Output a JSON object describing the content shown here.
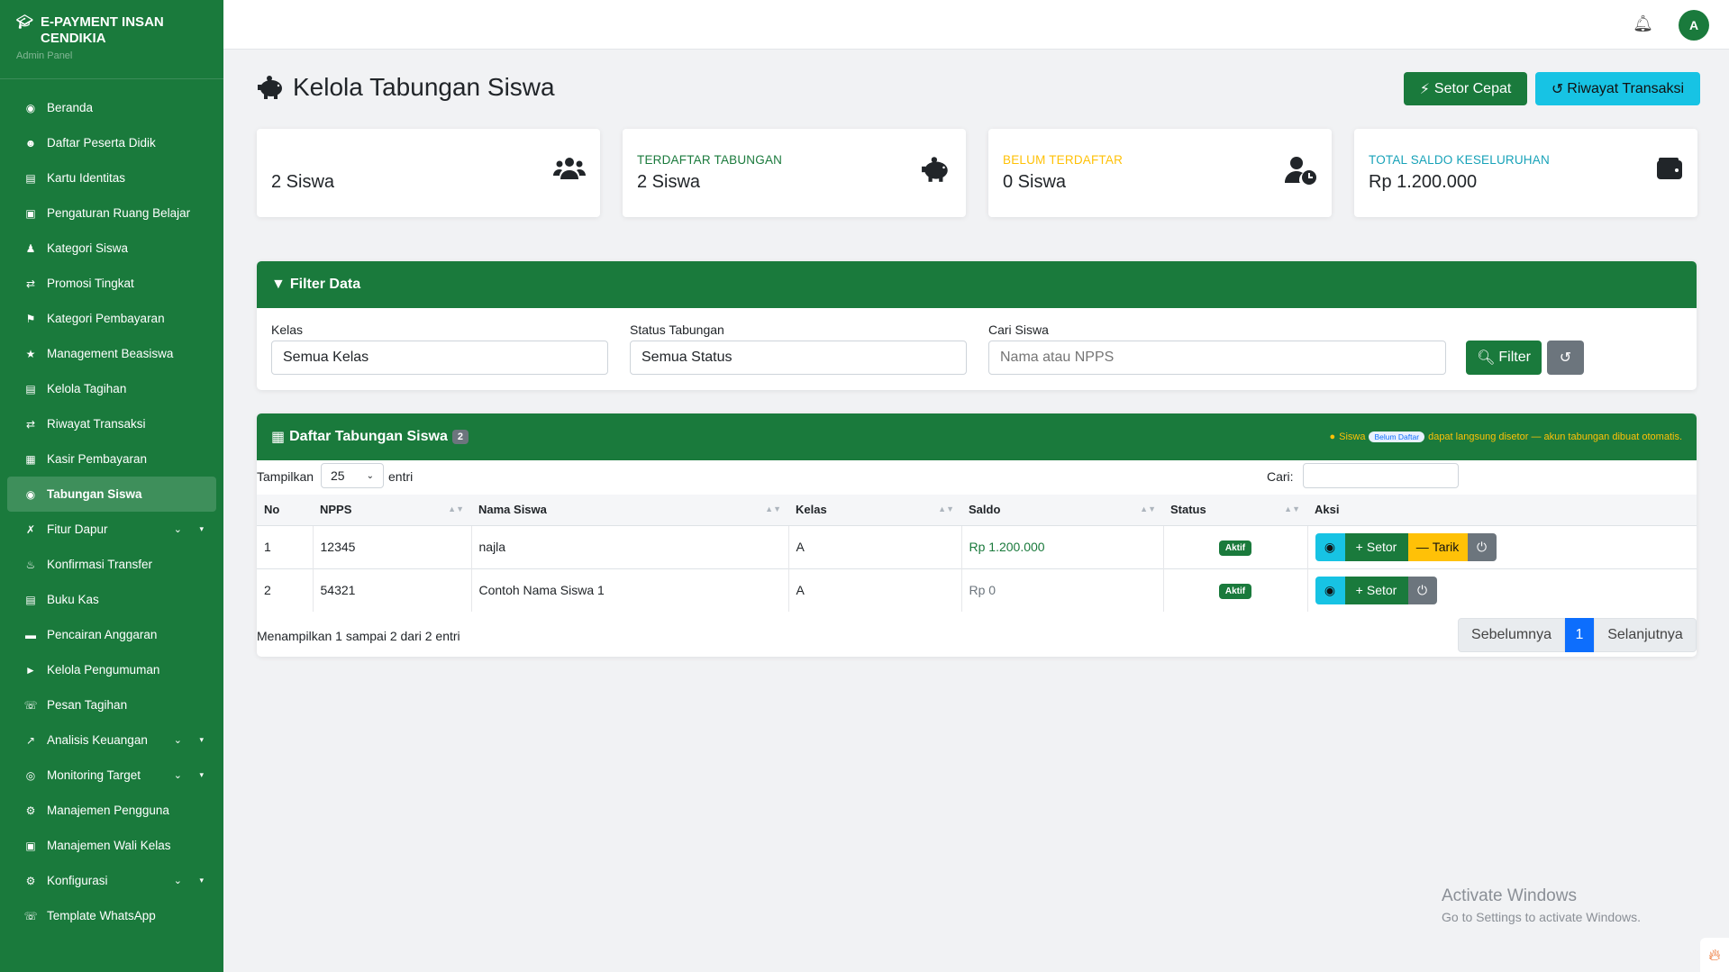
{
  "sidebar": {
    "brand_title": "E-PAYMENT INSAN CENDIKIA",
    "brand_sub": "Admin Panel",
    "items": [
      {
        "label": "Beranda",
        "icon": "dashboard-icon"
      },
      {
        "label": "Daftar Peserta Didik",
        "icon": "users-icon"
      },
      {
        "label": "Kartu Identitas",
        "icon": "id-card-icon"
      },
      {
        "label": "Pengaturan Ruang Belajar",
        "icon": "chalkboard-icon"
      },
      {
        "label": "Kategori Siswa",
        "icon": "child-icon"
      },
      {
        "label": "Promosi Tingkat",
        "icon": "exchange-icon"
      },
      {
        "label": "Kategori Pembayaran",
        "icon": "tags-icon"
      },
      {
        "label": "Management Beasiswa",
        "icon": "award-icon"
      },
      {
        "label": "Kelola Tagihan",
        "icon": "file-invoice-icon"
      },
      {
        "label": "Riwayat Transaksi",
        "icon": "exchange-icon"
      },
      {
        "label": "Kasir Pembayaran",
        "icon": "cash-register-icon"
      },
      {
        "label": "Tabungan Siswa",
        "icon": "piggy-bank-icon"
      },
      {
        "label": "Fitur Dapur",
        "icon": "utensils-icon"
      },
      {
        "label": "Konfirmasi Transfer",
        "icon": "bell-icon"
      },
      {
        "label": "Buku Kas",
        "icon": "book-icon"
      },
      {
        "label": "Pencairan Anggaran",
        "icon": "money-bill-icon"
      },
      {
        "label": "Kelola Pengumuman",
        "icon": "bullhorn-icon"
      },
      {
        "label": "Pesan Tagihan",
        "icon": "whatsapp-icon"
      },
      {
        "label": "Analisis Keuangan",
        "icon": "chart-line-icon"
      },
      {
        "label": "Monitoring Target",
        "icon": "bullseye-icon"
      },
      {
        "label": "Manajemen Pengguna",
        "icon": "user-cog-icon"
      },
      {
        "label": "Manajemen Wali Kelas",
        "icon": "chalkboard-teacher-icon"
      },
      {
        "label": "Konfigurasi",
        "icon": "gear-icon"
      },
      {
        "label": "Template WhatsApp",
        "icon": "whatsapp-icon"
      }
    ],
    "active_index": 11,
    "expandable_indices": [
      12,
      18,
      19,
      22
    ]
  },
  "topbar": {
    "avatar_letter": "A"
  },
  "page": {
    "title": "Kelola Tabungan Siswa",
    "btn_setor_cepat": "Setor Cepat",
    "btn_riwayat": "Riwayat Transaksi"
  },
  "stats": [
    {
      "label": "",
      "value": "2 Siswa",
      "color": "#212529",
      "icon": "users-icon"
    },
    {
      "label": "TERDAFTAR TABUNGAN",
      "value": "2 Siswa",
      "color": "#1a7a3c",
      "icon": "piggy-bank-icon"
    },
    {
      "label": "BELUM TERDAFTAR",
      "value": "0 Siswa",
      "color": "#ffc107",
      "icon": "user-clock-icon"
    },
    {
      "label": "TOTAL SALDO KESELURUHAN",
      "value": "Rp 1.200.000",
      "color": "#17a2b8",
      "icon": "wallet-icon"
    }
  ],
  "filter": {
    "title": "Filter Data",
    "kelas_label": "Kelas",
    "kelas_value": "Semua Kelas",
    "status_label": "Status Tabungan",
    "status_value": "Semua Status",
    "cari_label": "Cari Siswa",
    "cari_placeholder": "Nama atau NPPS",
    "btn_filter": "Filter"
  },
  "list": {
    "title": "Daftar Tabungan Siswa",
    "count": "2",
    "note_pre": "Siswa",
    "note_pill": "Belum Daftar",
    "note_post": "dapat langsung disetor — akun tabungan dibuat otomatis.",
    "len_label": "Tampilkan",
    "len_value": "25",
    "len_suffix": "entri",
    "search_label": "Cari:",
    "columns": [
      "No",
      "NPPS",
      "Nama Siswa",
      "Kelas",
      "Saldo",
      "Status",
      "Aksi"
    ],
    "rows": [
      {
        "no": "1",
        "npps": "12345",
        "nama": "najla",
        "kelas": "A",
        "saldo": "Rp 1.200.000",
        "status": "Aktif",
        "can_tarik": true
      },
      {
        "no": "2",
        "npps": "54321",
        "nama": "Contoh Nama Siswa 1",
        "kelas": "A",
        "saldo": "Rp 0",
        "status": "Aktif",
        "can_tarik": false
      }
    ],
    "btn_setor": "Setor",
    "btn_tarik": "Tarik",
    "info": "Menampilkan 1 sampai 2 dari 2 entri",
    "prev": "Sebelumnya",
    "page": "1",
    "next": "Selanjutnya"
  },
  "watermark": {
    "line1": "Activate Windows",
    "line2": "Go to Settings to activate Windows."
  }
}
